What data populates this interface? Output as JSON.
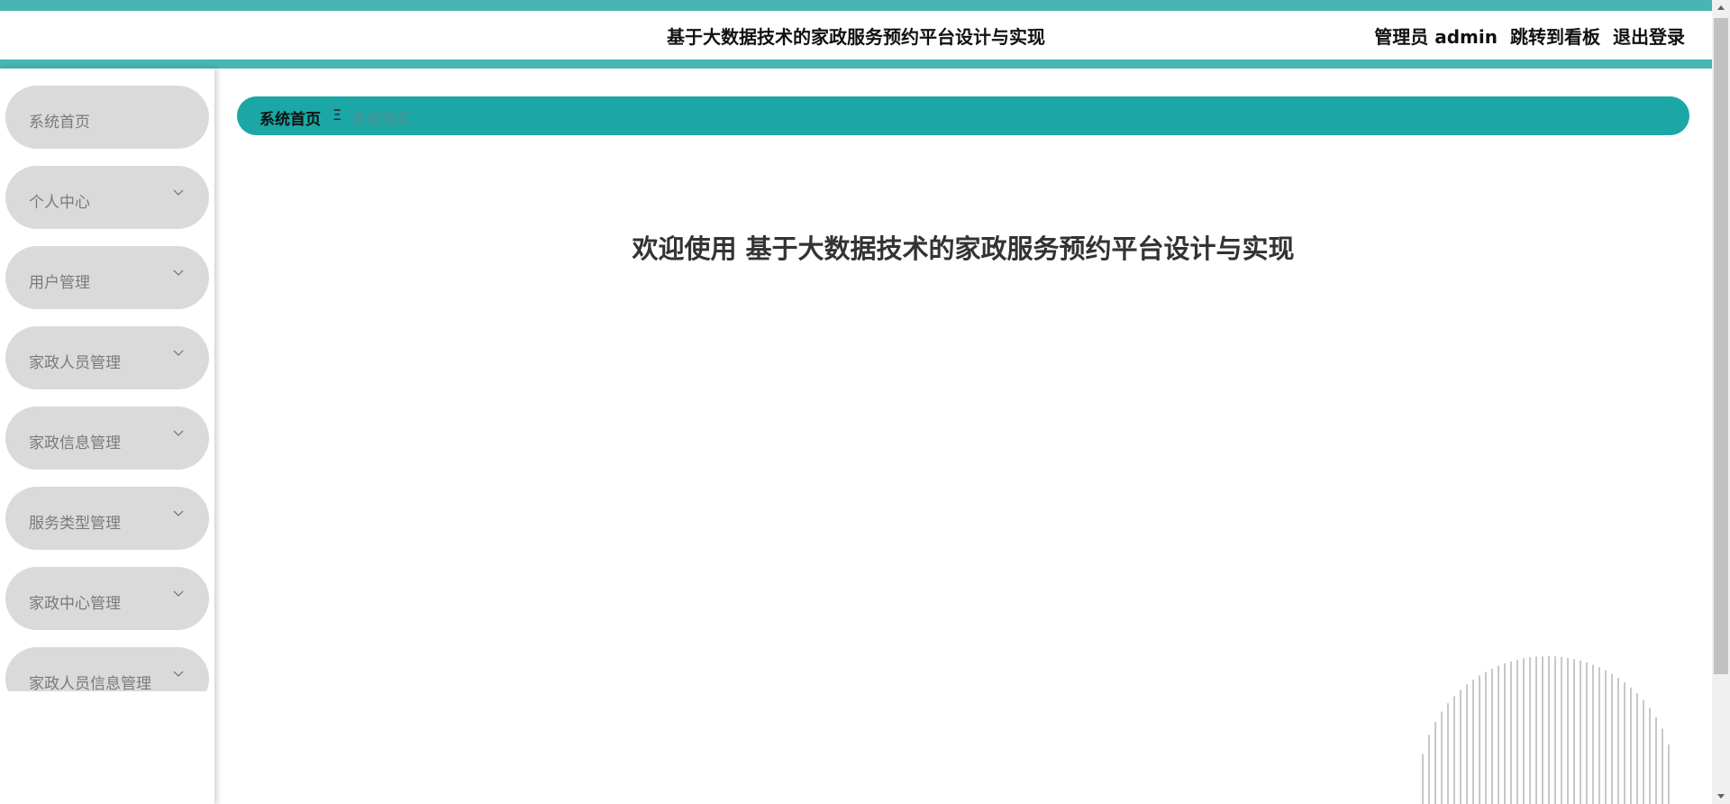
{
  "header": {
    "title": "基于大数据技术的家政服务预约平台设计与实现",
    "admin_label": "管理员 admin",
    "dashboard_link": "跳转到看板",
    "logout": "退出登录"
  },
  "sidebar": {
    "items": [
      {
        "label": "系统首页",
        "has_chevron": false
      },
      {
        "label": "个人中心",
        "has_chevron": true
      },
      {
        "label": "用户管理",
        "has_chevron": true
      },
      {
        "label": "家政人员管理",
        "has_chevron": true
      },
      {
        "label": "家政信息管理",
        "has_chevron": true
      },
      {
        "label": "服务类型管理",
        "has_chevron": true
      },
      {
        "label": "家政中心管理",
        "has_chevron": true
      },
      {
        "label": "家政人员信息管理",
        "has_chevron": true
      }
    ]
  },
  "breadcrumb": {
    "home": "系统首页",
    "separator": "Ξ",
    "current": "系统首页"
  },
  "main": {
    "welcome": "欢迎使用 基于大数据技术的家政服务预约平台设计与实现"
  },
  "colors": {
    "accent": "#47b5b2",
    "breadcrumb_bg": "#1aa7a6",
    "menu_bg": "#dadada"
  },
  "icons": {
    "chevron": "chevron-down-icon",
    "separator": "menu-separator-icon"
  }
}
